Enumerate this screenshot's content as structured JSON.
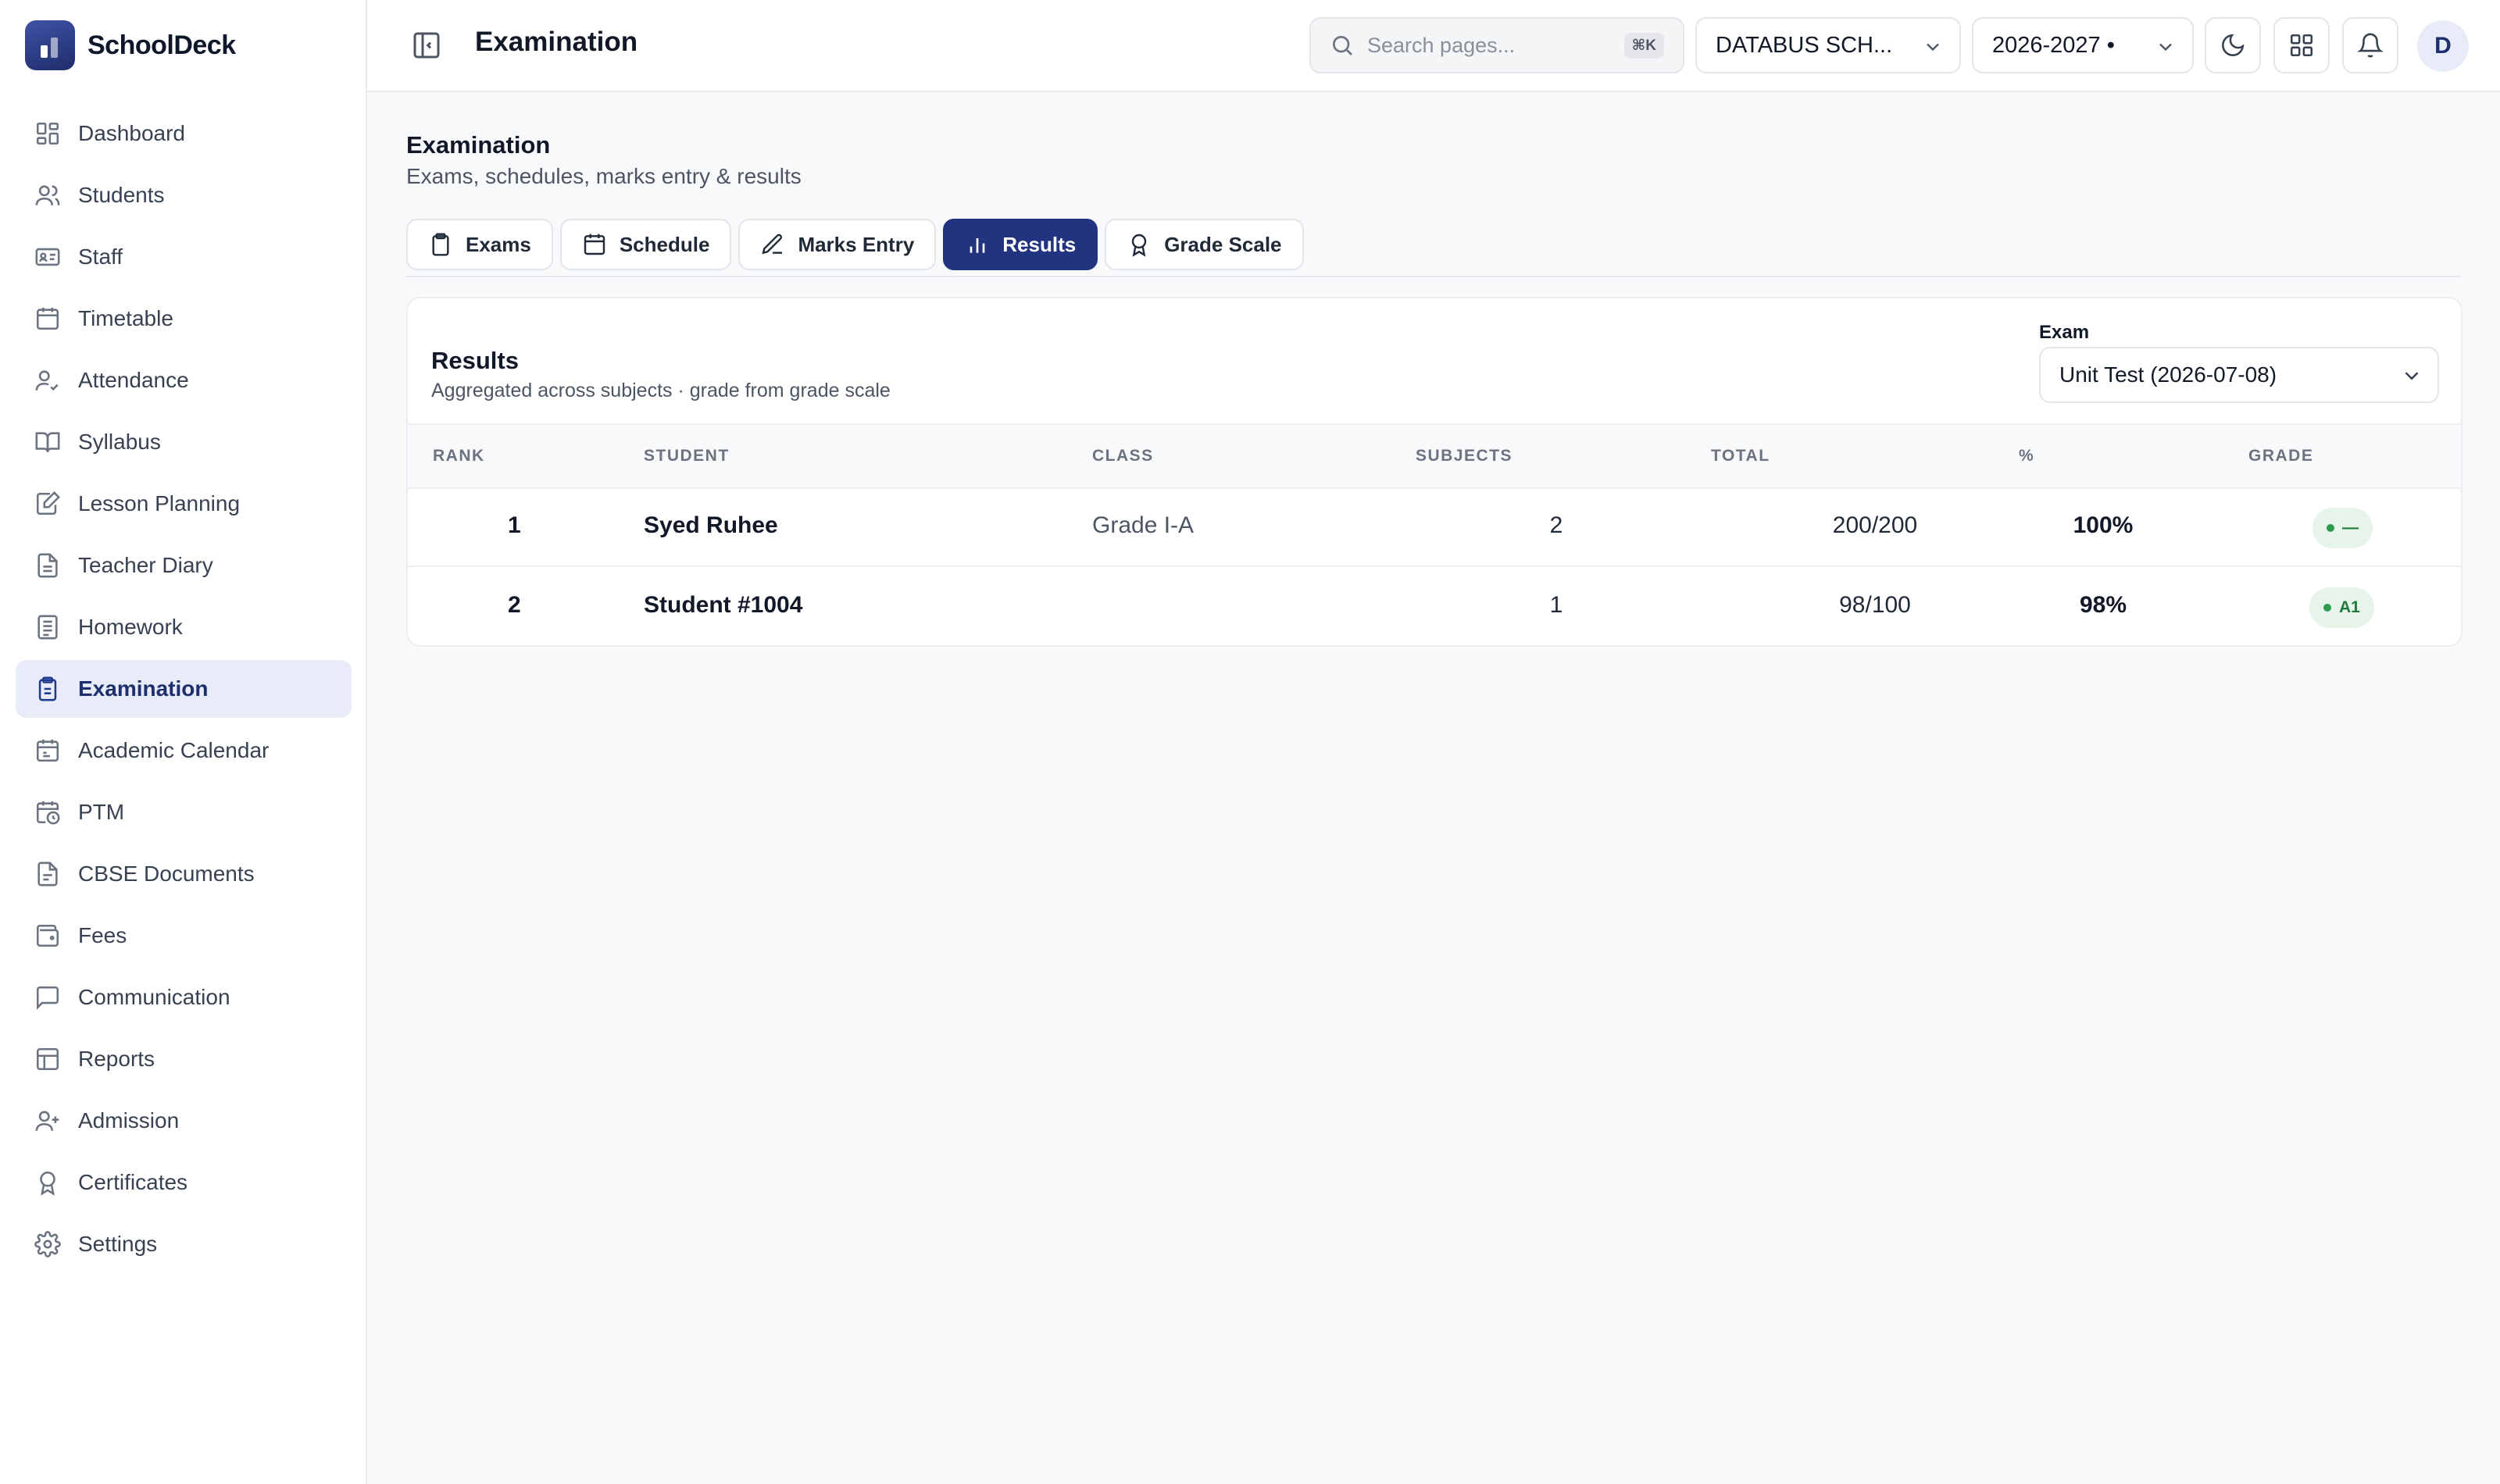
{
  "app": {
    "name": "SchoolDeck"
  },
  "sidebar": {
    "items": [
      {
        "label": "Dashboard",
        "icon": "dashboard-icon"
      },
      {
        "label": "Students",
        "icon": "users-icon"
      },
      {
        "label": "Staff",
        "icon": "id-card-icon"
      },
      {
        "label": "Timetable",
        "icon": "calendar-grid-icon"
      },
      {
        "label": "Attendance",
        "icon": "user-check-icon"
      },
      {
        "label": "Syllabus",
        "icon": "book-open-icon"
      },
      {
        "label": "Lesson Planning",
        "icon": "notebook-pen-icon"
      },
      {
        "label": "Teacher Diary",
        "icon": "file-text-icon"
      },
      {
        "label": "Homework",
        "icon": "list-doc-icon"
      },
      {
        "label": "Examination",
        "icon": "clipboard-icon",
        "active": true
      },
      {
        "label": "Academic Calendar",
        "icon": "calendar-icon"
      },
      {
        "label": "PTM",
        "icon": "calendar-clock-icon"
      },
      {
        "label": "CBSE Documents",
        "icon": "document-icon"
      },
      {
        "label": "Fees",
        "icon": "wallet-icon"
      },
      {
        "label": "Communication",
        "icon": "message-icon"
      },
      {
        "label": "Reports",
        "icon": "table-icon"
      },
      {
        "label": "Admission",
        "icon": "user-plus-icon"
      },
      {
        "label": "Certificates",
        "icon": "award-icon"
      },
      {
        "label": "Settings",
        "icon": "gear-icon"
      }
    ]
  },
  "topbar": {
    "title": "Examination",
    "search_placeholder": "Search pages...",
    "search_shortcut": "⌘K",
    "school": "DATABUS SCH...",
    "year": "2026-2027 •",
    "avatar_initial": "D"
  },
  "page": {
    "title": "Examination",
    "subtitle": "Exams, schedules, marks entry & results"
  },
  "tabs": [
    {
      "label": "Exams",
      "icon": "clipboard-icon"
    },
    {
      "label": "Schedule",
      "icon": "calendar-icon"
    },
    {
      "label": "Marks Entry",
      "icon": "pencil-icon"
    },
    {
      "label": "Results",
      "icon": "bar-chart-icon",
      "active": true
    },
    {
      "label": "Grade Scale",
      "icon": "award-icon"
    }
  ],
  "results": {
    "title": "Results",
    "subtitle": "Aggregated across subjects · grade from grade scale",
    "exam_label": "Exam",
    "exam_value": "Unit Test (2026-07-08)",
    "columns": [
      "RANK",
      "STUDENT",
      "CLASS",
      "SUBJECTS",
      "TOTAL",
      "%",
      "GRADE"
    ],
    "rows": [
      {
        "rank": "1",
        "student": "Syed Ruhee",
        "class": "Grade I-A",
        "subjects": "2",
        "total": "200/200",
        "percent": "100%",
        "grade": "—"
      },
      {
        "rank": "2",
        "student": "Student #1004",
        "class": "",
        "subjects": "1",
        "total": "98/100",
        "percent": "98%",
        "grade": "A1"
      }
    ]
  },
  "colors": {
    "primary": "#22347f",
    "active_nav_bg": "#e8ecf8",
    "grade_badge_bg": "#e6f4ea",
    "grade_badge_text": "#1f7a3a"
  }
}
